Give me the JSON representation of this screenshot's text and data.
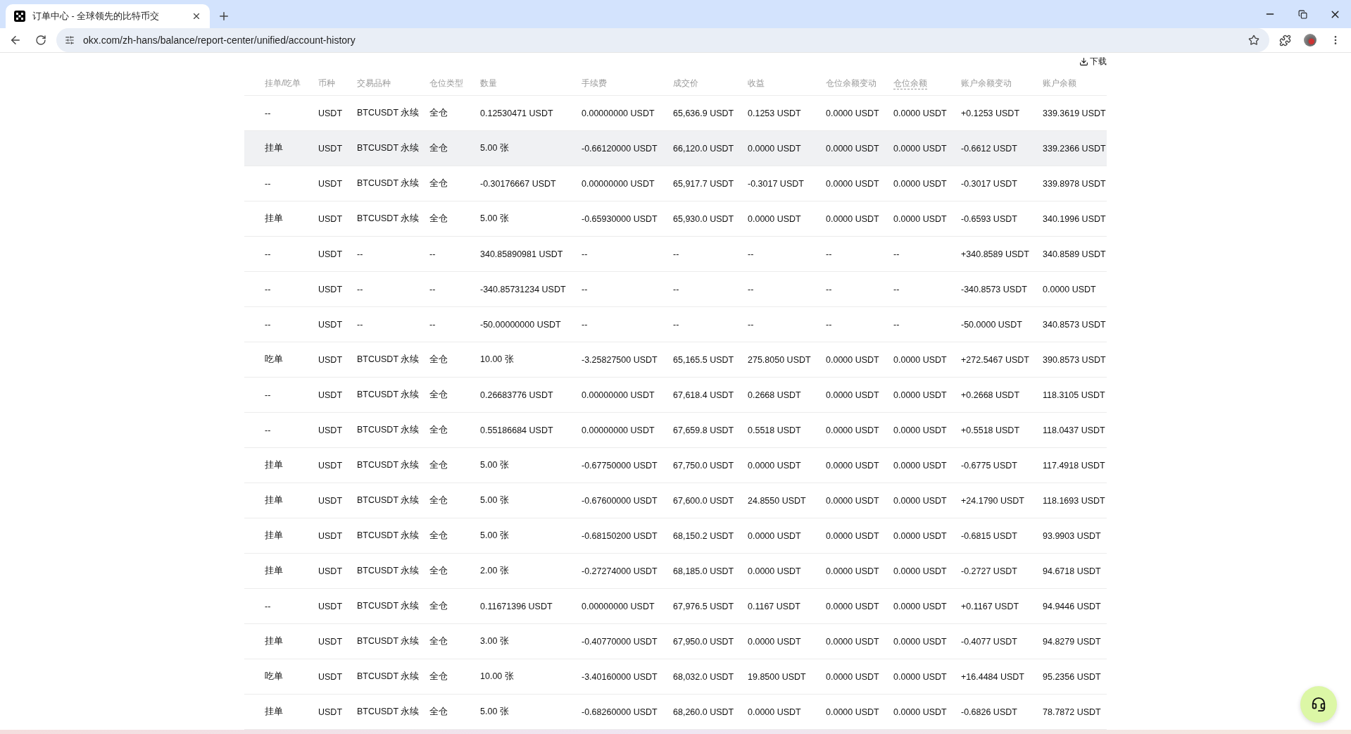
{
  "browser": {
    "tab_title": "订单中心 - 全球领先的比特币交",
    "url": "okx.com/zh-hans/balance/report-center/unified/account-history"
  },
  "download": "下载",
  "table": {
    "columns": [
      {
        "label": "挂单/吃单",
        "dashed": false
      },
      {
        "label": "币种",
        "dashed": false
      },
      {
        "label": "交易品种",
        "dashed": false
      },
      {
        "label": "仓位类型",
        "dashed": false
      },
      {
        "label": "数量",
        "dashed": false
      },
      {
        "label": "手续费",
        "dashed": false
      },
      {
        "label": "成交价",
        "dashed": false
      },
      {
        "label": "收益",
        "dashed": false
      },
      {
        "label": "仓位余额变动",
        "dashed": false
      },
      {
        "label": "仓位余额",
        "dashed": true
      },
      {
        "label": "账户余额变动",
        "dashed": false
      },
      {
        "label": "账户余额",
        "dashed": false
      }
    ],
    "rows": [
      {
        "highlighted": false,
        "cells": [
          "--",
          "USDT",
          "BTCUSDT 永续",
          "全仓",
          "0.12530471 USDT",
          "0.00000000 USDT",
          "65,636.9 USDT",
          "0.1253 USDT",
          "0.0000 USDT",
          "0.0000 USDT",
          "+0.1253 USDT",
          "339.3619 USDT"
        ]
      },
      {
        "highlighted": true,
        "cells": [
          "挂单",
          "USDT",
          "BTCUSDT 永续",
          "全仓",
          "5.00 张",
          "-0.66120000 USDT",
          "66,120.0 USDT",
          "0.0000 USDT",
          "0.0000 USDT",
          "0.0000 USDT",
          "-0.6612 USDT",
          "339.2366 USDT"
        ]
      },
      {
        "highlighted": false,
        "cells": [
          "--",
          "USDT",
          "BTCUSDT 永续",
          "全仓",
          "-0.30176667 USDT",
          "0.00000000 USDT",
          "65,917.7 USDT",
          "-0.3017 USDT",
          "0.0000 USDT",
          "0.0000 USDT",
          "-0.3017 USDT",
          "339.8978 USDT"
        ]
      },
      {
        "highlighted": false,
        "cells": [
          "挂单",
          "USDT",
          "BTCUSDT 永续",
          "全仓",
          "5.00 张",
          "-0.65930000 USDT",
          "65,930.0 USDT",
          "0.0000 USDT",
          "0.0000 USDT",
          "0.0000 USDT",
          "-0.6593 USDT",
          "340.1996 USDT"
        ]
      },
      {
        "highlighted": false,
        "cells": [
          "--",
          "USDT",
          "--",
          "--",
          "340.85890981 USDT",
          "--",
          "--",
          "--",
          "--",
          "--",
          "+340.8589 USDT",
          "340.8589 USDT"
        ]
      },
      {
        "highlighted": false,
        "cells": [
          "--",
          "USDT",
          "--",
          "--",
          "-340.85731234 USDT",
          "--",
          "--",
          "--",
          "--",
          "--",
          "-340.8573 USDT",
          "0.0000 USDT"
        ]
      },
      {
        "highlighted": false,
        "cells": [
          "--",
          "USDT",
          "--",
          "--",
          "-50.00000000 USDT",
          "--",
          "--",
          "--",
          "--",
          "--",
          "-50.0000 USDT",
          "340.8573 USDT"
        ]
      },
      {
        "highlighted": false,
        "cells": [
          "吃单",
          "USDT",
          "BTCUSDT 永续",
          "全仓",
          "10.00 张",
          "-3.25827500 USDT",
          "65,165.5 USDT",
          "275.8050 USDT",
          "0.0000 USDT",
          "0.0000 USDT",
          "+272.5467 USDT",
          "390.8573 USDT"
        ]
      },
      {
        "highlighted": false,
        "cells": [
          "--",
          "USDT",
          "BTCUSDT 永续",
          "全仓",
          "0.26683776 USDT",
          "0.00000000 USDT",
          "67,618.4 USDT",
          "0.2668 USDT",
          "0.0000 USDT",
          "0.0000 USDT",
          "+0.2668 USDT",
          "118.3105 USDT"
        ]
      },
      {
        "highlighted": false,
        "cells": [
          "--",
          "USDT",
          "BTCUSDT 永续",
          "全仓",
          "0.55186684 USDT",
          "0.00000000 USDT",
          "67,659.8 USDT",
          "0.5518 USDT",
          "0.0000 USDT",
          "0.0000 USDT",
          "+0.5518 USDT",
          "118.0437 USDT"
        ]
      },
      {
        "highlighted": false,
        "cells": [
          "挂单",
          "USDT",
          "BTCUSDT 永续",
          "全仓",
          "5.00 张",
          "-0.67750000 USDT",
          "67,750.0 USDT",
          "0.0000 USDT",
          "0.0000 USDT",
          "0.0000 USDT",
          "-0.6775 USDT",
          "117.4918 USDT"
        ]
      },
      {
        "highlighted": false,
        "cells": [
          "挂单",
          "USDT",
          "BTCUSDT 永续",
          "全仓",
          "5.00 张",
          "-0.67600000 USDT",
          "67,600.0 USDT",
          "24.8550 USDT",
          "0.0000 USDT",
          "0.0000 USDT",
          "+24.1790 USDT",
          "118.1693 USDT"
        ]
      },
      {
        "highlighted": false,
        "cells": [
          "挂单",
          "USDT",
          "BTCUSDT 永续",
          "全仓",
          "5.00 张",
          "-0.68150200 USDT",
          "68,150.2 USDT",
          "0.0000 USDT",
          "0.0000 USDT",
          "0.0000 USDT",
          "-0.6815 USDT",
          "93.9903 USDT"
        ]
      },
      {
        "highlighted": false,
        "cells": [
          "挂单",
          "USDT",
          "BTCUSDT 永续",
          "全仓",
          "2.00 张",
          "-0.27274000 USDT",
          "68,185.0 USDT",
          "0.0000 USDT",
          "0.0000 USDT",
          "0.0000 USDT",
          "-0.2727 USDT",
          "94.6718 USDT"
        ]
      },
      {
        "highlighted": false,
        "cells": [
          "--",
          "USDT",
          "BTCUSDT 永续",
          "全仓",
          "0.11671396 USDT",
          "0.00000000 USDT",
          "67,976.5 USDT",
          "0.1167 USDT",
          "0.0000 USDT",
          "0.0000 USDT",
          "+0.1167 USDT",
          "94.9446 USDT"
        ]
      },
      {
        "highlighted": false,
        "cells": [
          "挂单",
          "USDT",
          "BTCUSDT 永续",
          "全仓",
          "3.00 张",
          "-0.40770000 USDT",
          "67,950.0 USDT",
          "0.0000 USDT",
          "0.0000 USDT",
          "0.0000 USDT",
          "-0.4077 USDT",
          "94.8279 USDT"
        ]
      },
      {
        "highlighted": false,
        "cells": [
          "吃单",
          "USDT",
          "BTCUSDT 永续",
          "全仓",
          "10.00 张",
          "-3.40160000 USDT",
          "68,032.0 USDT",
          "19.8500 USDT",
          "0.0000 USDT",
          "0.0000 USDT",
          "+16.4484 USDT",
          "95.2356 USDT"
        ]
      },
      {
        "highlighted": false,
        "cells": [
          "挂单",
          "USDT",
          "BTCUSDT 永续",
          "全仓",
          "5.00 张",
          "-0.68260000 USDT",
          "68,260.0 USDT",
          "0.0000 USDT",
          "0.0000 USDT",
          "0.0000 USDT",
          "-0.6826 USDT",
          "78.7872 USDT"
        ]
      }
    ]
  }
}
